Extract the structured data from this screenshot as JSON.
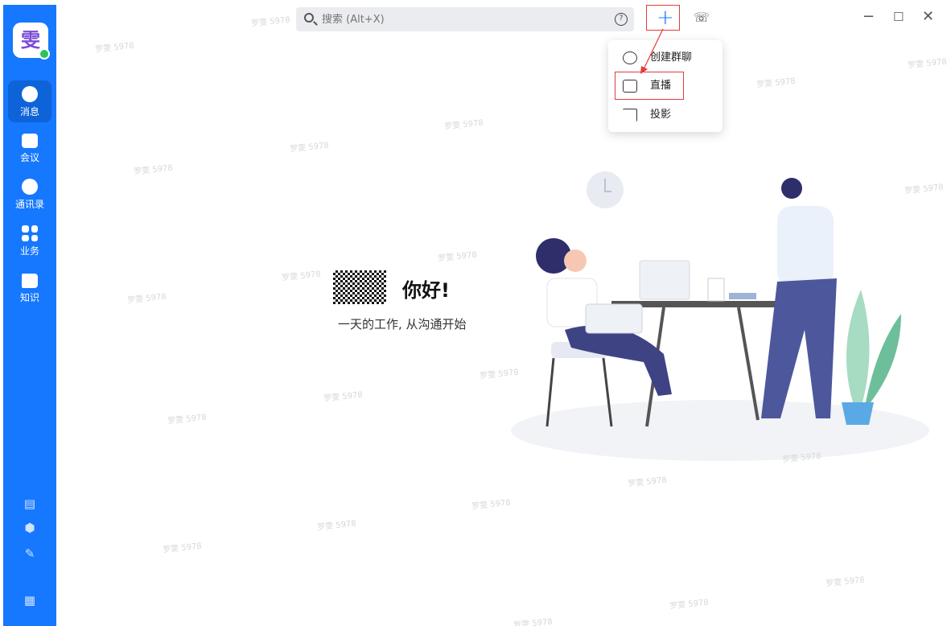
{
  "window": {
    "minimize": "−",
    "maximize": "☐",
    "close": "✕"
  },
  "sidebar": {
    "avatar_text": "雯",
    "items": [
      {
        "label": "消息",
        "icon": "message-icon"
      },
      {
        "label": "会议",
        "icon": "video-icon"
      },
      {
        "label": "通讯录",
        "icon": "contacts-icon"
      },
      {
        "label": "业务",
        "icon": "apps-grid-icon"
      },
      {
        "label": "知识",
        "icon": "book-icon"
      }
    ],
    "bottom_tools": [
      {
        "icon": "calendar-icon",
        "glyph": "▤"
      },
      {
        "icon": "cube-icon",
        "glyph": "⬢"
      },
      {
        "icon": "pen-icon",
        "glyph": "✎"
      },
      {
        "icon": "building-icon",
        "glyph": "▦"
      }
    ]
  },
  "search": {
    "placeholder": "搜索 (Alt+X)"
  },
  "toolbar": {
    "plus": "+",
    "help_glyph": "?",
    "call_glyph": "☏"
  },
  "menu": {
    "items": [
      {
        "label": "创建群聊",
        "icon": "group-chat-icon"
      },
      {
        "label": "直播",
        "icon": "live-icon"
      },
      {
        "label": "投影",
        "icon": "cast-icon"
      }
    ]
  },
  "welcome": {
    "greeting": "你好!",
    "subtitle": "一天的工作, 从沟通开始"
  },
  "watermark": "罗雯 5978",
  "colors": {
    "brand": "#1677ff",
    "highlight": "#e23b3b",
    "online": "#2bc25f"
  }
}
